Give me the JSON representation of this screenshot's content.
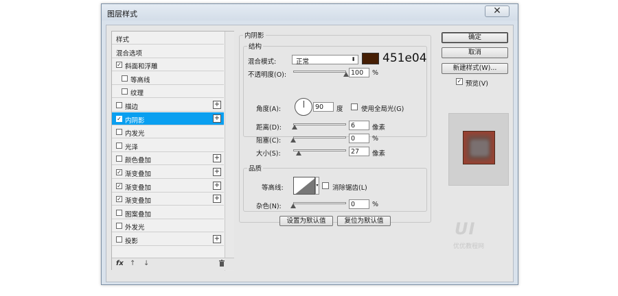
{
  "window": {
    "title": "图层样式",
    "close_glyph": "✕"
  },
  "style_list": {
    "items": [
      {
        "label": "样式",
        "checkbox": false,
        "checked": false,
        "plus": false,
        "selected": false,
        "indent": 0
      },
      {
        "label": "混合选项",
        "checkbox": false,
        "checked": false,
        "plus": false,
        "selected": false,
        "indent": 0
      },
      {
        "label": "斜面和浮雕",
        "checkbox": true,
        "checked": true,
        "plus": false,
        "selected": false,
        "indent": 0
      },
      {
        "label": "等高线",
        "checkbox": true,
        "checked": false,
        "plus": false,
        "selected": false,
        "indent": 1
      },
      {
        "label": "纹理",
        "checkbox": true,
        "checked": false,
        "plus": false,
        "selected": false,
        "indent": 1
      },
      {
        "label": "描边",
        "checkbox": true,
        "checked": false,
        "plus": true,
        "selected": false,
        "indent": 0
      },
      {
        "label": "内阴影",
        "checkbox": true,
        "checked": true,
        "plus": true,
        "selected": true,
        "indent": 0
      },
      {
        "label": "内发光",
        "checkbox": true,
        "checked": false,
        "plus": false,
        "selected": false,
        "indent": 0
      },
      {
        "label": "光泽",
        "checkbox": true,
        "checked": false,
        "plus": false,
        "selected": false,
        "indent": 0
      },
      {
        "label": "颜色叠加",
        "checkbox": true,
        "checked": false,
        "plus": true,
        "selected": false,
        "indent": 0
      },
      {
        "label": "渐变叠加",
        "checkbox": true,
        "checked": true,
        "plus": true,
        "selected": false,
        "indent": 0
      },
      {
        "label": "渐变叠加",
        "checkbox": true,
        "checked": true,
        "plus": true,
        "selected": false,
        "indent": 0
      },
      {
        "label": "渐变叠加",
        "checkbox": true,
        "checked": true,
        "plus": true,
        "selected": false,
        "indent": 0
      },
      {
        "label": "图案叠加",
        "checkbox": true,
        "checked": false,
        "plus": false,
        "selected": false,
        "indent": 0
      },
      {
        "label": "外发光",
        "checkbox": true,
        "checked": false,
        "plus": false,
        "selected": false,
        "indent": 0
      },
      {
        "label": "投影",
        "checkbox": true,
        "checked": false,
        "plus": true,
        "selected": false,
        "indent": 0
      }
    ],
    "bottom": {
      "fx": "fx",
      "up_arrow": "↑",
      "down_arrow": "↓",
      "trash": "trash-icon"
    }
  },
  "inner_shadow": {
    "section_title": "内阴影",
    "structure_title": "结构",
    "blend_mode_label": "混合模式:",
    "blend_mode_value": "正常",
    "color_hex": "451e04",
    "color": "#451e04",
    "opacity_label": "不透明度(O):",
    "opacity_value": "100",
    "opacity_unit": "%",
    "opacity_fraction": 1.0,
    "angle_label": "角度(A):",
    "angle_value": "90",
    "angle_unit": "度",
    "global_light_label": "使用全局光(G)",
    "global_light_checked": false,
    "distance_label": "距离(D):",
    "distance_value": "6",
    "distance_unit": "像素",
    "distance_fraction": 0.02,
    "choke_label": "阻塞(C):",
    "choke_value": "0",
    "choke_unit": "%",
    "choke_fraction": 0.0,
    "size_label": "大小(S):",
    "size_value": "27",
    "size_unit": "像素",
    "size_fraction": 0.11,
    "quality_title": "品质",
    "contour_label": "等高线:",
    "antialias_label": "消除锯齿(L)",
    "antialias_checked": false,
    "noise_label": "杂色(N):",
    "noise_value": "0",
    "noise_unit": "%",
    "noise_fraction": 0.0,
    "set_default_label": "设置为默认值",
    "reset_default_label": "复位为默认值"
  },
  "actions": {
    "ok_label": "确定",
    "cancel_label": "取消",
    "new_style_label": "新建样式(W)...",
    "preview_label": "预览(V)",
    "preview_checked": true
  },
  "watermark": {
    "big": "UI",
    "small": "优优教程网"
  }
}
